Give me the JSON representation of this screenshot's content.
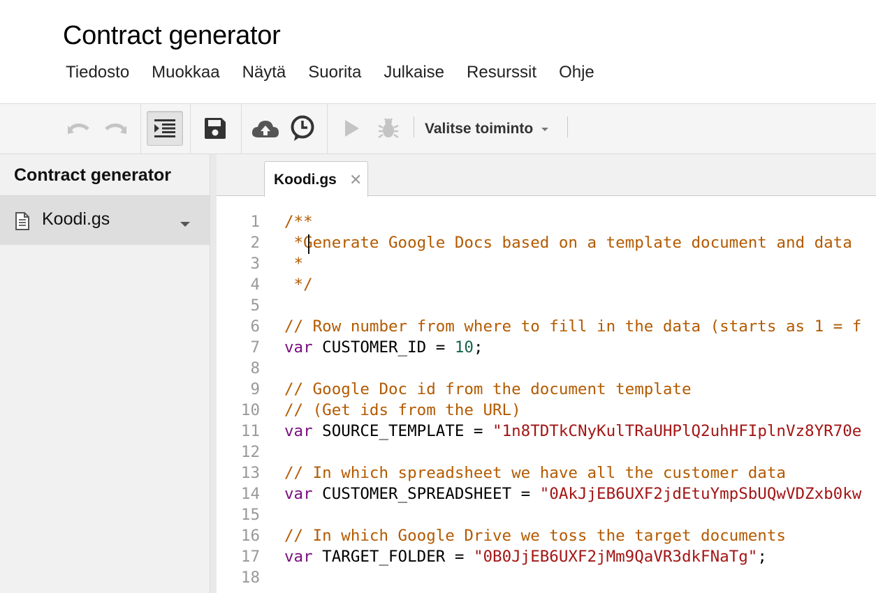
{
  "app": {
    "title": "Contract generator"
  },
  "menu": [
    "Tiedosto",
    "Muokkaa",
    "Näytä",
    "Suorita",
    "Julkaise",
    "Resurssit",
    "Ohje"
  ],
  "toolbar": {
    "buttons": [
      {
        "name": "undo",
        "icon": "undo-icon",
        "enabled": false
      },
      {
        "name": "redo",
        "icon": "redo-icon",
        "enabled": false
      },
      {
        "name": "indent",
        "icon": "indent-icon",
        "active": true
      },
      {
        "name": "save",
        "icon": "save-icon"
      },
      {
        "name": "deploy",
        "icon": "cloud-upload-icon"
      },
      {
        "name": "triggers",
        "icon": "clock-icon"
      },
      {
        "name": "run",
        "icon": "play-icon",
        "enabled": false
      },
      {
        "name": "debug",
        "icon": "bug-icon",
        "enabled": false
      }
    ],
    "function_select": "Valitse toiminto"
  },
  "sidebar": {
    "project_title": "Contract generator",
    "files": [
      {
        "name": "Koodi.gs",
        "icon": "file-icon",
        "selected": true
      }
    ]
  },
  "tabs": [
    {
      "label": "Koodi.gs",
      "close": "✕"
    }
  ],
  "editor": {
    "lines": [
      {
        "n": "1",
        "tokens": [
          {
            "t": "cm",
            "v": "/**"
          }
        ]
      },
      {
        "n": "2",
        "tokens": [
          {
            "t": "cm",
            "v": " *Generate Google Docs based on a template document and data"
          }
        ]
      },
      {
        "n": "3",
        "tokens": [
          {
            "t": "cm",
            "v": " *"
          }
        ]
      },
      {
        "n": "4",
        "tokens": [
          {
            "t": "cm",
            "v": " */"
          }
        ]
      },
      {
        "n": "5",
        "tokens": []
      },
      {
        "n": "6",
        "tokens": [
          {
            "t": "cm",
            "v": "// Row number from where to fill in the data (starts as 1 = f"
          }
        ]
      },
      {
        "n": "7",
        "tokens": [
          {
            "t": "kw",
            "v": "var"
          },
          {
            "t": "pl",
            "v": " CUSTOMER_ID = "
          },
          {
            "t": "num",
            "v": "10"
          },
          {
            "t": "pl",
            "v": ";"
          }
        ]
      },
      {
        "n": "8",
        "tokens": []
      },
      {
        "n": "9",
        "tokens": [
          {
            "t": "cm",
            "v": "// Google Doc id from the document template"
          }
        ]
      },
      {
        "n": "10",
        "tokens": [
          {
            "t": "cm",
            "v": "// (Get ids from the URL)"
          }
        ]
      },
      {
        "n": "11",
        "tokens": [
          {
            "t": "kw",
            "v": "var"
          },
          {
            "t": "pl",
            "v": " SOURCE_TEMPLATE = "
          },
          {
            "t": "str",
            "v": "\"1n8TDTkCNyKulTRaUHPlQ2uhHFIplnVz8YR70e"
          }
        ]
      },
      {
        "n": "12",
        "tokens": []
      },
      {
        "n": "13",
        "tokens": [
          {
            "t": "cm",
            "v": "// In which spreadsheet we have all the customer data"
          }
        ]
      },
      {
        "n": "14",
        "tokens": [
          {
            "t": "kw",
            "v": "var"
          },
          {
            "t": "pl",
            "v": " CUSTOMER_SPREADSHEET = "
          },
          {
            "t": "str",
            "v": "\"0AkJjEB6UXF2jdEtuYmpSbUQwVDZxb0kw"
          }
        ]
      },
      {
        "n": "15",
        "tokens": []
      },
      {
        "n": "16",
        "tokens": [
          {
            "t": "cm",
            "v": "// In which Google Drive we toss the target documents"
          }
        ]
      },
      {
        "n": "17",
        "tokens": [
          {
            "t": "kw",
            "v": "var"
          },
          {
            "t": "pl",
            "v": " TARGET_FOLDER = "
          },
          {
            "t": "str",
            "v": "\"0B0JjEB6UXF2jMm9QaVR3dkFNaTg\""
          },
          {
            "t": "pl",
            "v": ";"
          }
        ]
      },
      {
        "n": "18",
        "tokens": []
      }
    ]
  }
}
